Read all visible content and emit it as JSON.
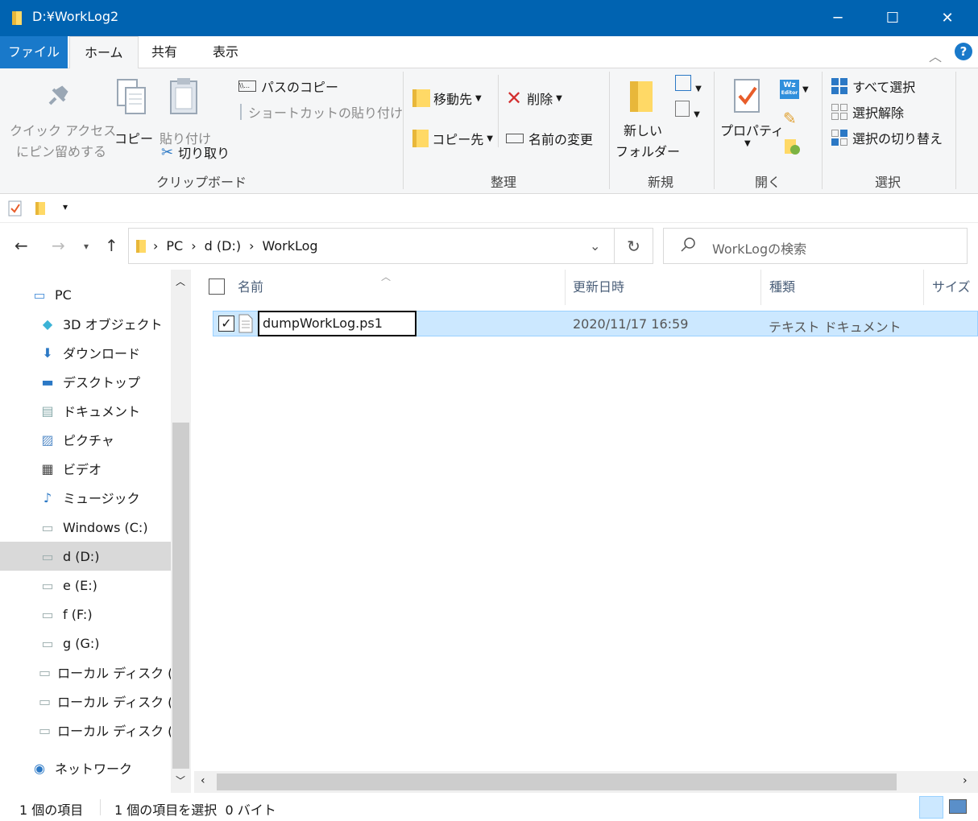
{
  "window": {
    "title": "D:¥WorkLog2",
    "controls": {
      "minimize": "─",
      "maximize": "☐",
      "close": "✕"
    }
  },
  "ribbon_tabs": {
    "file": "ファイル",
    "home": "ホーム",
    "share": "共有",
    "view": "表示",
    "help": "?"
  },
  "ribbon": {
    "clipboard": {
      "pin_line1": "クイック アクセス",
      "pin_line2": "にピン留めする",
      "copy": "コピー",
      "paste": "貼り付け",
      "copy_path": "パスのコピー",
      "paste_shortcut": "ショートカットの貼り付け",
      "cut": "切り取り",
      "label": "クリップボード"
    },
    "organize": {
      "move_to": "移動先",
      "copy_to": "コピー先",
      "delete": "削除",
      "rename": "名前の変更",
      "label": "整理"
    },
    "new": {
      "new_folder_line1": "新しい",
      "new_folder_line2": "フォルダー",
      "label": "新規"
    },
    "open": {
      "properties": "プロパティ",
      "wz_line1": "Wz",
      "wz_line2": "Editor",
      "label": "開く"
    },
    "select": {
      "select_all": "すべて選択",
      "select_none": "選択解除",
      "invert": "選択の切り替え",
      "label": "選択"
    }
  },
  "address": {
    "crumbs": [
      "PC",
      "d (D:)",
      "WorkLog"
    ],
    "search_placeholder": "WorkLogの検索"
  },
  "nav_items": [
    {
      "label": "PC",
      "icon": "pc-icon"
    },
    {
      "label": "3D オブジェクト",
      "icon": "cube-icon"
    },
    {
      "label": "ダウンロード",
      "icon": "download-icon"
    },
    {
      "label": "デスクトップ",
      "icon": "desktop-icon"
    },
    {
      "label": "ドキュメント",
      "icon": "document-icon"
    },
    {
      "label": "ピクチャ",
      "icon": "picture-icon"
    },
    {
      "label": "ビデオ",
      "icon": "video-icon"
    },
    {
      "label": "ミュージック",
      "icon": "music-icon"
    },
    {
      "label": "Windows (C:)",
      "icon": "drive-icon"
    },
    {
      "label": "d (D:)",
      "icon": "drive-icon"
    },
    {
      "label": "e (E:)",
      "icon": "drive-icon"
    },
    {
      "label": "f (F:)",
      "icon": "drive-icon"
    },
    {
      "label": "g (G:)",
      "icon": "drive-icon"
    },
    {
      "label": "ローカル ディスク (H:)",
      "icon": "drive-icon"
    },
    {
      "label": "ローカル ディスク (I:)",
      "icon": "drive-icon"
    },
    {
      "label": "ローカル ディスク (J:)",
      "icon": "drive-icon"
    },
    {
      "label": "ネットワーク",
      "icon": "network-icon"
    }
  ],
  "columns": {
    "name": "名前",
    "modified": "更新日時",
    "type": "種類",
    "size": "サイズ"
  },
  "files": [
    {
      "name": "dumpWorkLog.ps1",
      "modified": "2020/11/17 16:59",
      "type": "テキスト ドキュメント"
    }
  ],
  "status": {
    "count": "1 個の項目",
    "selected": "1 個の項目を選択  0 バイト"
  },
  "colors": {
    "titlebar": "#0063b1",
    "file_tab": "#1979ca",
    "selection": "#cce8ff"
  }
}
